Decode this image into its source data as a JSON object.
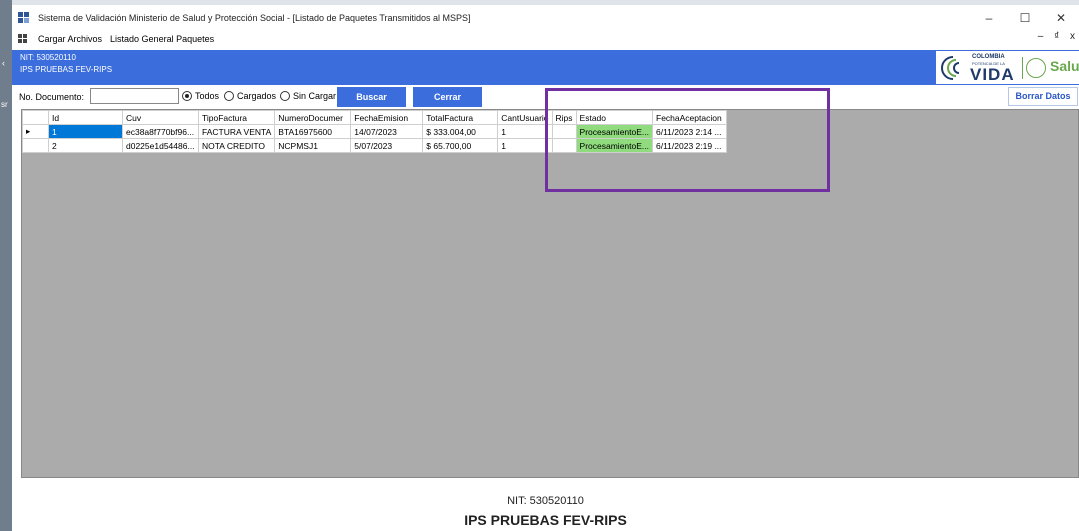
{
  "window": {
    "title": "Sistema de Validación Ministerio de Salud y Protección Social - [Listado de Paquetes Transmitidos al MSPS]",
    "minimize": "–",
    "maximize": "☐",
    "close": "✕"
  },
  "menu": {
    "items": [
      "Cargar Archivos",
      "Listado General Paquetes"
    ],
    "mdi_controls": "– ₫ x"
  },
  "header": {
    "nit": "NIT: 530520110",
    "ips": "IPS PRUEBAS FEV-RIPS",
    "logo_colombia": "COLOMBIA",
    "logo_potencia": "POTENCIA DE LA",
    "logo_vida": "VIDA",
    "logo_salud": "Salud"
  },
  "toolbar": {
    "doc_label": "No. Documento:",
    "doc_value": "",
    "radios": [
      {
        "label": "Todos",
        "checked": true
      },
      {
        "label": "Cargados",
        "checked": false
      },
      {
        "label": "Sin Cargar",
        "checked": false
      }
    ],
    "buscar": "Buscar",
    "cerrar": "Cerrar",
    "borrar": "Borrar Datos"
  },
  "grid": {
    "columns": [
      "Id",
      "Cuv",
      "TipoFactura",
      "NumeroDocumer",
      "FechaEmision",
      "TotalFactura",
      "CantUsuario",
      "Rips",
      "Estado",
      "FechaAceptacion"
    ],
    "rows": [
      [
        "1",
        "ec38a8f770bf96...",
        "FACTURA VENTA",
        "BTA16975600",
        "14/07/2023",
        "$ 333.004,00",
        "1",
        "",
        "ProcesamientoE...",
        "6/11/2023 2:14 ..."
      ],
      [
        "2",
        "d0225e1d54486...",
        "NOTA CREDITO",
        "NCPMSJ1",
        "5/07/2023",
        "$ 65.700,00",
        "1",
        "",
        "ProcesamientoE...",
        "6/11/2023 2:19 ..."
      ]
    ],
    "row_marker": "▸"
  },
  "footer": {
    "nit": "NIT: 530520110",
    "ips": "IPS PRUEBAS FEV-RIPS"
  },
  "desktop": {
    "chevron": "‹",
    "label": "sr"
  },
  "colors": {
    "header_blue": "#3b6ddc",
    "selection_blue": "#0078d7",
    "estado_green": "#8fdb7e",
    "highlight_purple": "#7030a0"
  }
}
